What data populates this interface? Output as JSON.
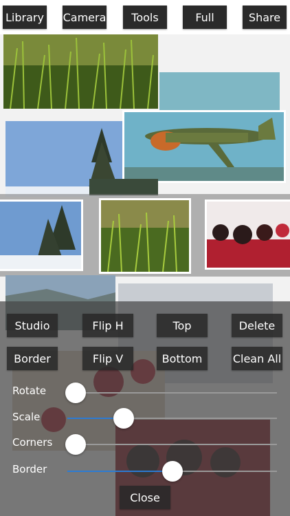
{
  "toolbar": {
    "library": "Library",
    "camera": "Camera",
    "tools": "Tools",
    "full": "Full",
    "share": "Share"
  },
  "panel": {
    "row1": [
      "Studio",
      "Flip H",
      "Top",
      "Delete"
    ],
    "row2": [
      "Border",
      "Flip V",
      "Bottom",
      "Clean All"
    ],
    "sliders": [
      {
        "label": "Rotate",
        "value": 0.04
      },
      {
        "label": "Scale",
        "value": 0.27
      },
      {
        "label": "Corners",
        "value": 0.04
      },
      {
        "label": "Border",
        "value": 0.5
      }
    ],
    "close": "Close"
  },
  "colors": {
    "accent": "#2b7bd4",
    "button_bg": "#2a2a2a"
  }
}
